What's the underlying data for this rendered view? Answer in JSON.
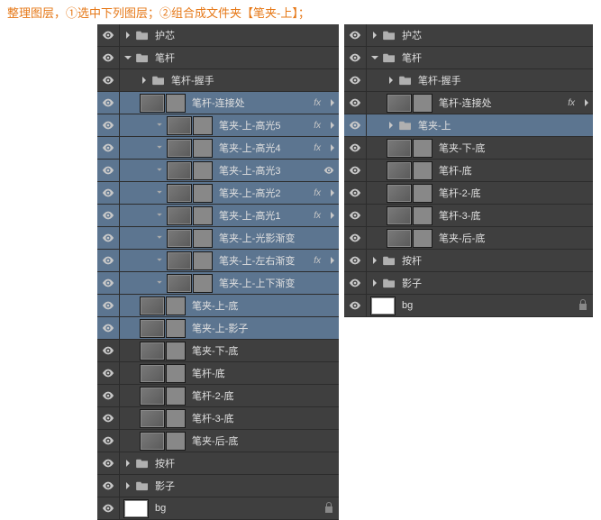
{
  "instruction": "整理图层，①选中下列图层；②组合成文件夹【笔夹-上】；",
  "icons": {
    "fx": "fx"
  },
  "left": [
    {
      "t": "folder",
      "i": 0,
      "a": "right",
      "n": "护芯",
      "sel": false
    },
    {
      "t": "folder",
      "i": 0,
      "a": "down",
      "n": "笔杆",
      "sel": false
    },
    {
      "t": "folder",
      "i": 1,
      "a": "right",
      "n": "笔杆-握手",
      "sel": false
    },
    {
      "t": "layer",
      "i": 1,
      "n": "笔杆-连接处",
      "sel": true,
      "fx": true,
      "mask": true
    },
    {
      "t": "layer",
      "i": 2,
      "n": "笔夹-上-高光5",
      "sel": true,
      "fx": true,
      "mask": true,
      "link": true
    },
    {
      "t": "layer",
      "i": 2,
      "n": "笔夹-上-高光4",
      "sel": true,
      "fx": true,
      "mask": true,
      "link": true
    },
    {
      "t": "layer",
      "i": 2,
      "n": "笔夹-上-高光3",
      "sel": true,
      "fx": false,
      "mask": true,
      "link": true,
      "extraEye": true
    },
    {
      "t": "layer",
      "i": 2,
      "n": "笔夹-上-高光2",
      "sel": true,
      "fx": true,
      "mask": true,
      "link": true
    },
    {
      "t": "layer",
      "i": 2,
      "n": "笔夹-上-高光1",
      "sel": true,
      "fx": true,
      "mask": true,
      "link": true
    },
    {
      "t": "layer",
      "i": 2,
      "n": "笔夹-上-光影渐变",
      "sel": true,
      "fx": false,
      "mask": true,
      "link": true
    },
    {
      "t": "layer",
      "i": 2,
      "n": "笔夹-上-左右渐变",
      "sel": true,
      "fx": true,
      "mask": true,
      "link": true
    },
    {
      "t": "layer",
      "i": 2,
      "n": "笔夹-上-上下渐变",
      "sel": true,
      "fx": false,
      "mask": true,
      "link": true
    },
    {
      "t": "layer",
      "i": 1,
      "n": "笔夹-上-底",
      "sel": true,
      "fx": false,
      "mask": true
    },
    {
      "t": "layer",
      "i": 1,
      "n": "笔夹-上-影子",
      "sel": true,
      "fx": false,
      "mask": true
    },
    {
      "t": "layer",
      "i": 1,
      "n": "笔夹-下-底",
      "sel": false,
      "fx": false,
      "mask": true
    },
    {
      "t": "layer",
      "i": 1,
      "n": "笔杆-底",
      "sel": false,
      "fx": false,
      "mask": true
    },
    {
      "t": "layer",
      "i": 1,
      "n": "笔杆-2-底",
      "sel": false,
      "fx": false,
      "mask": true
    },
    {
      "t": "layer",
      "i": 1,
      "n": "笔杆-3-底",
      "sel": false,
      "fx": false,
      "mask": true
    },
    {
      "t": "layer",
      "i": 1,
      "n": "笔夹-后-底",
      "sel": false,
      "fx": false,
      "mask": true
    },
    {
      "t": "folder",
      "i": 0,
      "a": "right",
      "n": "按杆",
      "sel": false
    },
    {
      "t": "folder",
      "i": 0,
      "a": "right",
      "n": "影子",
      "sel": false
    },
    {
      "t": "bg",
      "i": 0,
      "n": "bg",
      "sel": false,
      "lock": true
    }
  ],
  "right": [
    {
      "t": "folder",
      "i": 0,
      "a": "right",
      "n": "护芯",
      "sel": false
    },
    {
      "t": "folder",
      "i": 0,
      "a": "down",
      "n": "笔杆",
      "sel": false
    },
    {
      "t": "folder",
      "i": 1,
      "a": "right",
      "n": "笔杆-握手",
      "sel": false
    },
    {
      "t": "layer",
      "i": 1,
      "n": "笔杆-连接处",
      "sel": false,
      "fx": true,
      "mask": true
    },
    {
      "t": "folder",
      "i": 1,
      "a": "right",
      "n": "笔夹-上",
      "sel": true
    },
    {
      "t": "layer",
      "i": 1,
      "n": "笔夹-下-底",
      "sel": false,
      "fx": false,
      "mask": true
    },
    {
      "t": "layer",
      "i": 1,
      "n": "笔杆-底",
      "sel": false,
      "fx": false,
      "mask": true
    },
    {
      "t": "layer",
      "i": 1,
      "n": "笔杆-2-底",
      "sel": false,
      "fx": false,
      "mask": true
    },
    {
      "t": "layer",
      "i": 1,
      "n": "笔杆-3-底",
      "sel": false,
      "fx": false,
      "mask": true
    },
    {
      "t": "layer",
      "i": 1,
      "n": "笔夹-后-底",
      "sel": false,
      "fx": false,
      "mask": true
    },
    {
      "t": "folder",
      "i": 0,
      "a": "right",
      "n": "按杆",
      "sel": false
    },
    {
      "t": "folder",
      "i": 0,
      "a": "right",
      "n": "影子",
      "sel": false
    },
    {
      "t": "bg",
      "i": 0,
      "n": "bg",
      "sel": false,
      "lock": true
    }
  ]
}
